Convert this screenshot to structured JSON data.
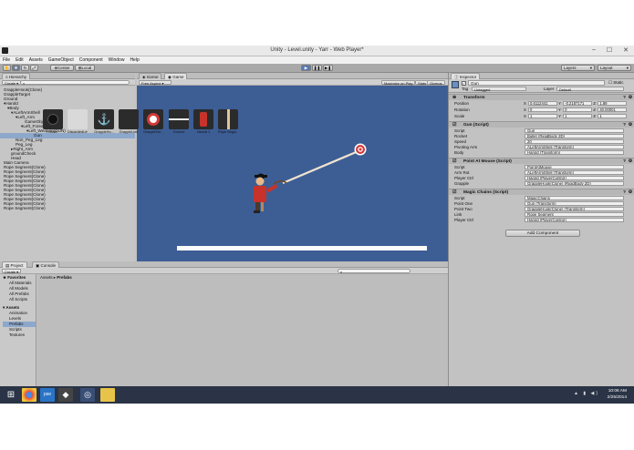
{
  "window": {
    "title": "Unity - Level.unity - Yarr - Web Player*",
    "minimize": "–",
    "maximize": "☐",
    "close": "✕"
  },
  "menu": [
    "File",
    "Edit",
    "Assets",
    "GameObject",
    "Component",
    "Window",
    "Help"
  ],
  "toolbar": {
    "pivot": "Center",
    "space": "Local",
    "layers": "Layers",
    "layout": "Layout"
  },
  "hierarchy": {
    "tab": "Hierarchy",
    "create": "Create",
    "items": [
      "GrappleHook(Clone)",
      "GrappleTarget",
      "Ground",
      "Harold",
      "Body",
      "ALeftArmShell",
      "Left_Arm",
      "GameObject",
      "Left_Forearm",
      "Left_Weapon(GUN)",
      "Gun",
      "Non_Peg_Leg",
      "Peg_Leg",
      "Right_Arm",
      "groundCheck",
      "Head",
      "Main Camera",
      "Rope Segment(Clone)",
      "Rope Segment(Clone)",
      "Rope Segment(Clone)",
      "Rope Segment(Clone)",
      "Rope Segment(Clone)",
      "Rope Segment(Clone)",
      "Rope Segment(Clone)",
      "Rope Segment(Clone)",
      "Rope Segment(Clone)",
      "Rope Segment(Clone)"
    ]
  },
  "game_view": {
    "tabs": [
      "Scene",
      "Game"
    ],
    "aspect": "Free Aspect",
    "options": [
      "Maximize on Play",
      "Stats",
      "Gizmos"
    ]
  },
  "project": {
    "tabs": [
      "Project",
      "Console"
    ],
    "create": "Create",
    "favorites_label": "Favorites",
    "favorites": [
      "All Materials",
      "All Models",
      "All Prefabs",
      "All Scripts"
    ],
    "assets_label": "Assets",
    "folders": [
      "Animation",
      "Levels",
      "Prefabs",
      "Scripts",
      "Textures"
    ],
    "breadcrumb": [
      "Assets",
      "Prefabs"
    ],
    "assets": [
      "Bullet",
      "DiscardedLev...",
      "GrappleHo...",
      "GrappleLine",
      "GrappleTar...",
      "Ground",
      "Harold 1",
      "Rope Segm..."
    ]
  },
  "inspector": {
    "tab": "Inspector",
    "object_name": "Gun",
    "static": "Static",
    "tag_label": "Tag",
    "tag": "Untagged",
    "layer_label": "Layer",
    "layer": "Default",
    "transform": {
      "title": "Transform",
      "position": [
        "0.6112441",
        "-0.2187171",
        "1.89"
      ],
      "rotation": [
        "0",
        "0",
        "40.00001"
      ],
      "scale": [
        "1",
        "1",
        "1"
      ]
    },
    "gun_script": {
      "title": "Gun (Script)",
      "rows": [
        [
          "Script",
          "Gun"
        ],
        [
          "Rocket",
          "Bullet (RigidBody 2D)"
        ],
        [
          "Speed",
          "20"
        ],
        [
          "Pivoting Arm",
          "ALeftArmShell (Transform)"
        ],
        [
          "Body",
          "Harold (Transform)"
        ]
      ]
    },
    "point_at_mouse": {
      "title": "Point At Mouse (Script)",
      "rows": [
        [
          "Script",
          "PointAtMouse"
        ],
        [
          "Arm Rot",
          "ALeftArmShell (Transform)"
        ],
        [
          "Player Ctrl",
          "Harold (PlayerControl)"
        ],
        [
          "Grapple",
          "GrappleHook(Clone) (RigidBody 2D)"
        ]
      ]
    },
    "magic_chains": {
      "title": "Magic Chains (Script)",
      "rows": [
        [
          "Script",
          "MagicChains"
        ],
        [
          "Point One",
          "Gun (Transform)"
        ],
        [
          "Point Two",
          "GrappleHook(Clone) (Transform)"
        ],
        [
          "Link",
          "Rope Segment"
        ],
        [
          "Player Ctrl",
          "Harold (PlayerControl)"
        ]
      ]
    },
    "add_component": "Add Component"
  },
  "taskbar": {
    "time": "10:06 AM",
    "date": "2/25/2014",
    "pse": "pse"
  },
  "colors": {
    "game_bg": "#3d5e95",
    "target_red": "#d23a3a",
    "rope": "#f0e4cf",
    "taskbar": "#2a3446"
  }
}
